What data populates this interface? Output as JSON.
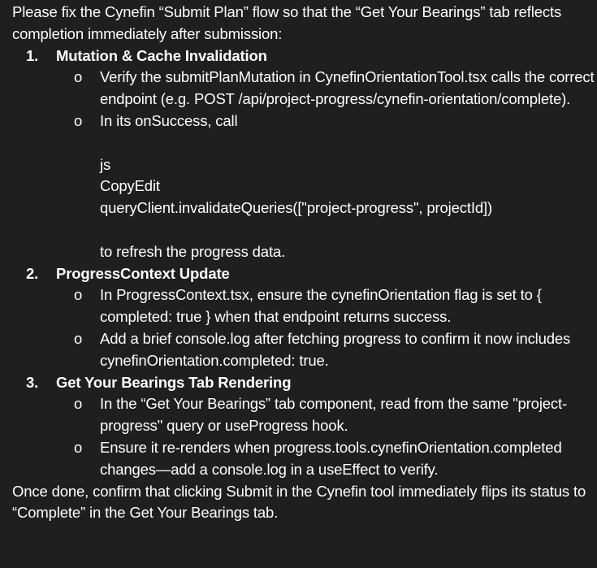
{
  "intro": "Please fix the Cynefin “Submit Plan” flow so that the “Get Your Bearings” tab reflects completion immediately after submission:",
  "sections": [
    {
      "number": "1.",
      "heading": "Mutation & Cache Invalidation",
      "bullets": [
        "Verify the submitPlanMutation in CynefinOrientationTool.tsx calls the correct endpoint (e.g. POST /api/project-progress/cynefin-orientation/complete).",
        "In its onSuccess, call"
      ],
      "code": {
        "lang": "js",
        "copy_label": "CopyEdit",
        "line": "queryClient.invalidateQueries([\"project-progress\", projectId])"
      },
      "after_code": "to refresh the progress data."
    },
    {
      "number": "2.",
      "heading": "ProgressContext Update",
      "bullets": [
        "In ProgressContext.tsx, ensure the cynefinOrientation flag is set to { completed: true } when that endpoint returns success.",
        "Add a brief console.log after fetching progress to confirm it now includes cynefinOrientation.completed: true."
      ]
    },
    {
      "number": "3.",
      "heading": "Get Your Bearings Tab Rendering",
      "bullets": [
        "In the “Get Your Bearings” tab component, read from the same \"project-progress\" query or useProgress hook.",
        "Ensure it re-renders when progress.tools.cynefinOrientation.completed changes—add a console.log in a useEffect to verify."
      ]
    }
  ],
  "outro": "Once done, confirm that clicking Submit in the Cynefin tool immediately flips its status to “Complete” in the Get Your Bearings tab.",
  "bullet_glyph": "o"
}
